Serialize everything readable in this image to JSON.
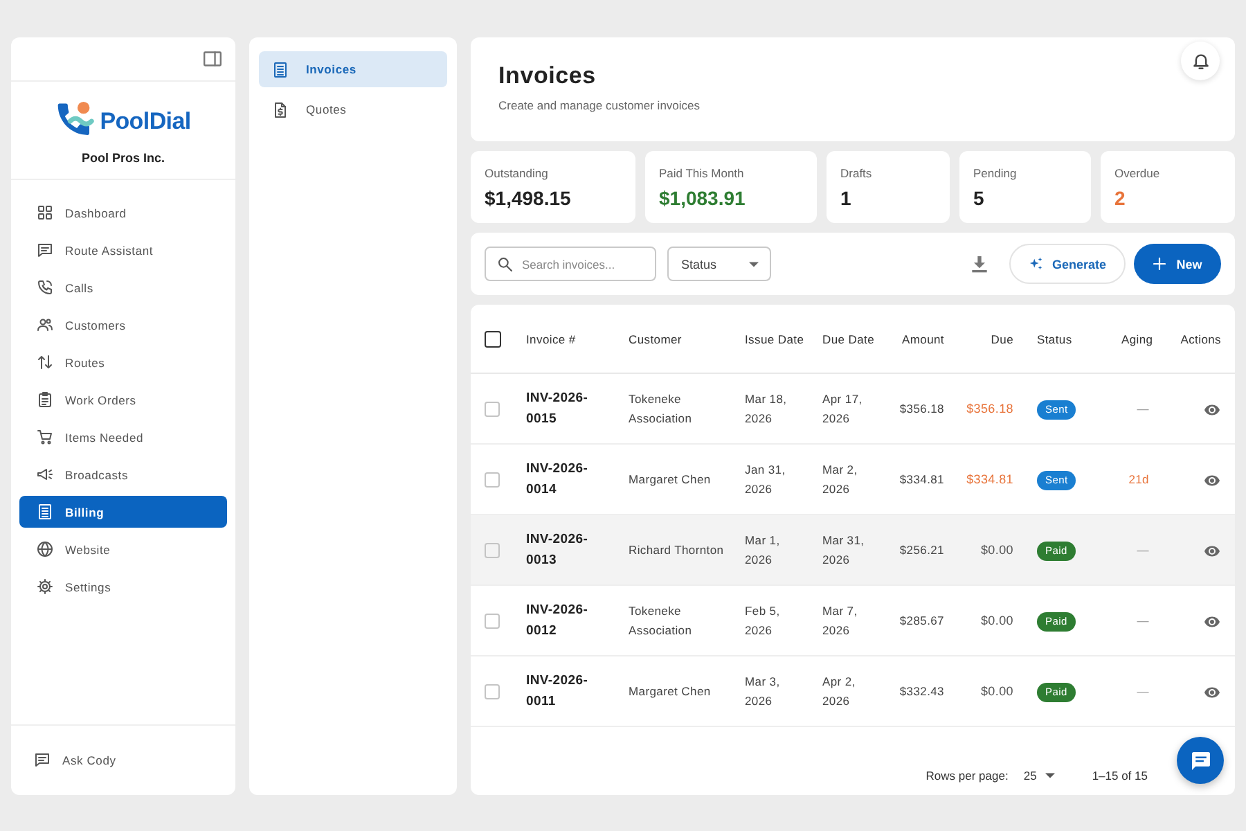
{
  "sidebar": {
    "logo_text": "PoolDial",
    "company": "Pool Pros Inc.",
    "items": [
      {
        "label": "Dashboard",
        "selected": false
      },
      {
        "label": "Route Assistant",
        "selected": false
      },
      {
        "label": "Calls",
        "selected": false
      },
      {
        "label": "Customers",
        "selected": false
      },
      {
        "label": "Routes",
        "selected": false
      },
      {
        "label": "Work Orders",
        "selected": false
      },
      {
        "label": "Items Needed",
        "selected": false
      },
      {
        "label": "Broadcasts",
        "selected": false
      },
      {
        "label": "Billing",
        "selected": true
      },
      {
        "label": "Website",
        "selected": false
      },
      {
        "label": "Settings",
        "selected": false
      }
    ],
    "footer_item": {
      "label": "Ask Cody"
    }
  },
  "subnav": {
    "items": [
      {
        "label": "Invoices",
        "selected": true
      },
      {
        "label": "Quotes",
        "selected": false
      }
    ]
  },
  "header": {
    "title": "Invoices",
    "subtitle": "Create and manage customer invoices"
  },
  "stats": [
    {
      "label": "Outstanding",
      "value": "$1,498.15",
      "kind": "plain"
    },
    {
      "label": "Paid This Month",
      "value": "$1,083.91",
      "kind": "positive"
    },
    {
      "label": "Drafts",
      "value": "1",
      "kind": "plain"
    },
    {
      "label": "Pending",
      "value": "5",
      "kind": "plain"
    },
    {
      "label": "Overdue",
      "value": "2",
      "kind": "warning"
    }
  ],
  "toolbar": {
    "search": {
      "placeholder": "Search invoices..."
    },
    "status_filter": {
      "label": "Status"
    },
    "buttons": [
      {
        "label": "Generate",
        "kind": "outline"
      },
      {
        "label": "New",
        "kind": "primary"
      }
    ]
  },
  "table": {
    "select_all": {
      "checked": false
    },
    "columns": [
      "Invoice #",
      "Customer",
      "Issue Date",
      "Due Date",
      "Amount",
      "Due",
      "Status",
      "Aging",
      "Actions"
    ],
    "rows": [
      {
        "invoice": "INV-2026-0015",
        "customer": "Tokeneke Association",
        "issue_date": "Mar 18, 2026",
        "due_date": "Apr 17, 2026",
        "amount": "$356.18",
        "due": "$356.18",
        "due_unpaid": true,
        "status": {
          "label": "Sent",
          "color": "#1a7fd1"
        },
        "aging": "—",
        "aging_overdue": false,
        "checked": false,
        "highlighted": false
      },
      {
        "invoice": "INV-2026-0014",
        "customer": "Margaret Chen",
        "issue_date": "Jan 31, 2026",
        "due_date": "Mar 2, 2026",
        "amount": "$334.81",
        "due": "$334.81",
        "due_unpaid": true,
        "status": {
          "label": "Sent",
          "color": "#1a7fd1"
        },
        "aging": "21d",
        "aging_overdue": true,
        "checked": false,
        "highlighted": false
      },
      {
        "invoice": "INV-2026-0013",
        "customer": "Richard Thornton",
        "issue_date": "Mar 1, 2026",
        "due_date": "Mar 31, 2026",
        "amount": "$256.21",
        "due": "$0.00",
        "due_unpaid": false,
        "status": {
          "label": "Paid",
          "color": "#2e7d32"
        },
        "aging": "—",
        "aging_overdue": false,
        "checked": false,
        "highlighted": true
      },
      {
        "invoice": "INV-2026-0012",
        "customer": "Tokeneke Association",
        "issue_date": "Feb 5, 2026",
        "due_date": "Mar 7, 2026",
        "amount": "$285.67",
        "due": "$0.00",
        "due_unpaid": false,
        "status": {
          "label": "Paid",
          "color": "#2e7d32"
        },
        "aging": "—",
        "aging_overdue": false,
        "checked": false,
        "highlighted": false
      },
      {
        "invoice": "INV-2026-0011",
        "customer": "Margaret Chen",
        "issue_date": "Mar 3, 2026",
        "due_date": "Apr 2, 2026",
        "amount": "$332.43",
        "due": "$0.00",
        "due_unpaid": false,
        "status": {
          "label": "Paid",
          "color": "#2e7d32"
        },
        "aging": "—",
        "aging_overdue": false,
        "checked": false,
        "highlighted": false
      }
    ]
  },
  "pagination": {
    "rows_per_page_label": "Rows per page:",
    "rows_per_page": "25",
    "range": "1–15 of 15"
  }
}
